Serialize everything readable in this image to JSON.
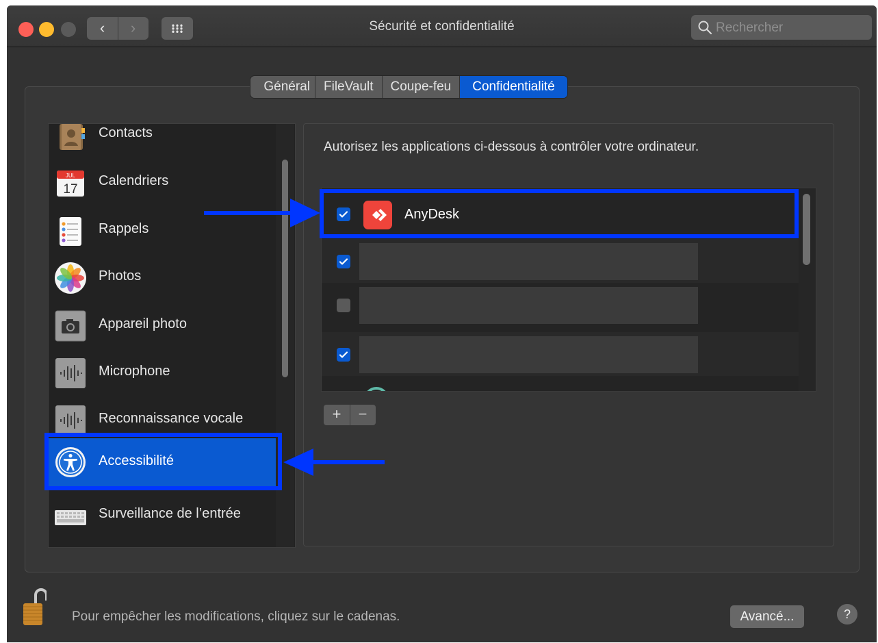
{
  "window": {
    "title": "Sécurité et confidentialité",
    "search_placeholder": "Rechercher",
    "nav": {
      "back": "‹",
      "forward": "›"
    }
  },
  "tabs": [
    {
      "label": "Général",
      "active": false
    },
    {
      "label": "FileVault",
      "active": false
    },
    {
      "label": "Coupe-feu",
      "active": false
    },
    {
      "label": "Confidentialité",
      "active": true
    }
  ],
  "sidebar": {
    "items": [
      {
        "label": "Contacts",
        "icon": "contacts-icon"
      },
      {
        "label": "Calendriers",
        "icon": "calendar-icon",
        "icon_month": "JUL",
        "icon_day": "17"
      },
      {
        "label": "Rappels",
        "icon": "reminders-icon"
      },
      {
        "label": "Photos",
        "icon": "photos-icon"
      },
      {
        "label": "Appareil photo",
        "icon": "camera-icon"
      },
      {
        "label": "Microphone",
        "icon": "microphone-icon"
      },
      {
        "label": "Reconnaissance vocale",
        "icon": "speech-recognition-icon"
      },
      {
        "label": "Accessibilité",
        "icon": "accessibility-icon",
        "selected": true
      },
      {
        "label": "Surveillance de l’entrée",
        "icon": "keyboard-icon"
      }
    ]
  },
  "main": {
    "description": "Autorisez les applications ci-dessous à contrôler votre ordinateur.",
    "apps": [
      {
        "name": "AnyDesk",
        "checked": true,
        "icon": "anydesk-icon",
        "highlighted": true
      },
      {
        "name": "",
        "checked": true,
        "redacted": true
      },
      {
        "name": "",
        "checked": false,
        "redacted": true
      },
      {
        "name": "",
        "checked": true,
        "redacted": true
      }
    ],
    "add_label": "+",
    "remove_label": "−"
  },
  "footer": {
    "lock_text": "Pour empêcher les modifications, cliquez sur le cadenas.",
    "advanced_label": "Avancé...",
    "help_label": "?"
  },
  "colors": {
    "accent": "#0a5ad1",
    "annotation": "#0036ff",
    "anydesk": "#ef443b"
  }
}
